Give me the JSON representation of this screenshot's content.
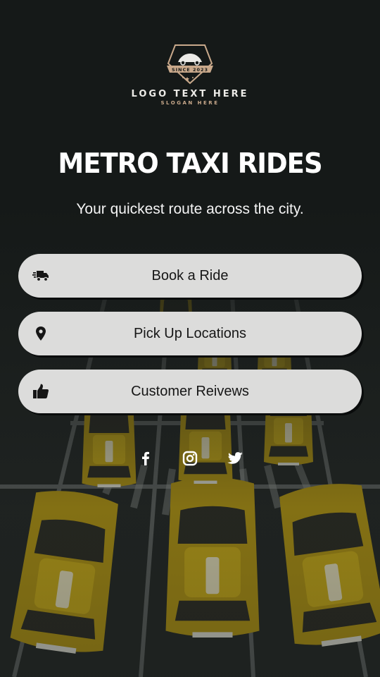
{
  "logo": {
    "badge_text": "SINCE 2023",
    "name": "LOGO TEXT HERE",
    "slogan": "SLOGAN HERE"
  },
  "hero": {
    "title": "METRO TAXI RIDES",
    "subtitle": "Your quickest route across the city."
  },
  "menu": [
    {
      "label": "Book a Ride",
      "icon": "shipping-fast-icon"
    },
    {
      "label": "Pick Up Locations",
      "icon": "map-pin-icon"
    },
    {
      "label": "Customer Reivews",
      "icon": "thumbs-up-icon"
    }
  ],
  "social": [
    {
      "icon": "facebook-icon"
    },
    {
      "icon": "instagram-icon"
    },
    {
      "icon": "twitter-icon"
    }
  ],
  "colors": {
    "background": "#151918",
    "button_bg": "#dcdcdb",
    "button_text": "#161616",
    "logo_gold": "#c9a98b",
    "taxi_yellow": "#b89a14"
  }
}
